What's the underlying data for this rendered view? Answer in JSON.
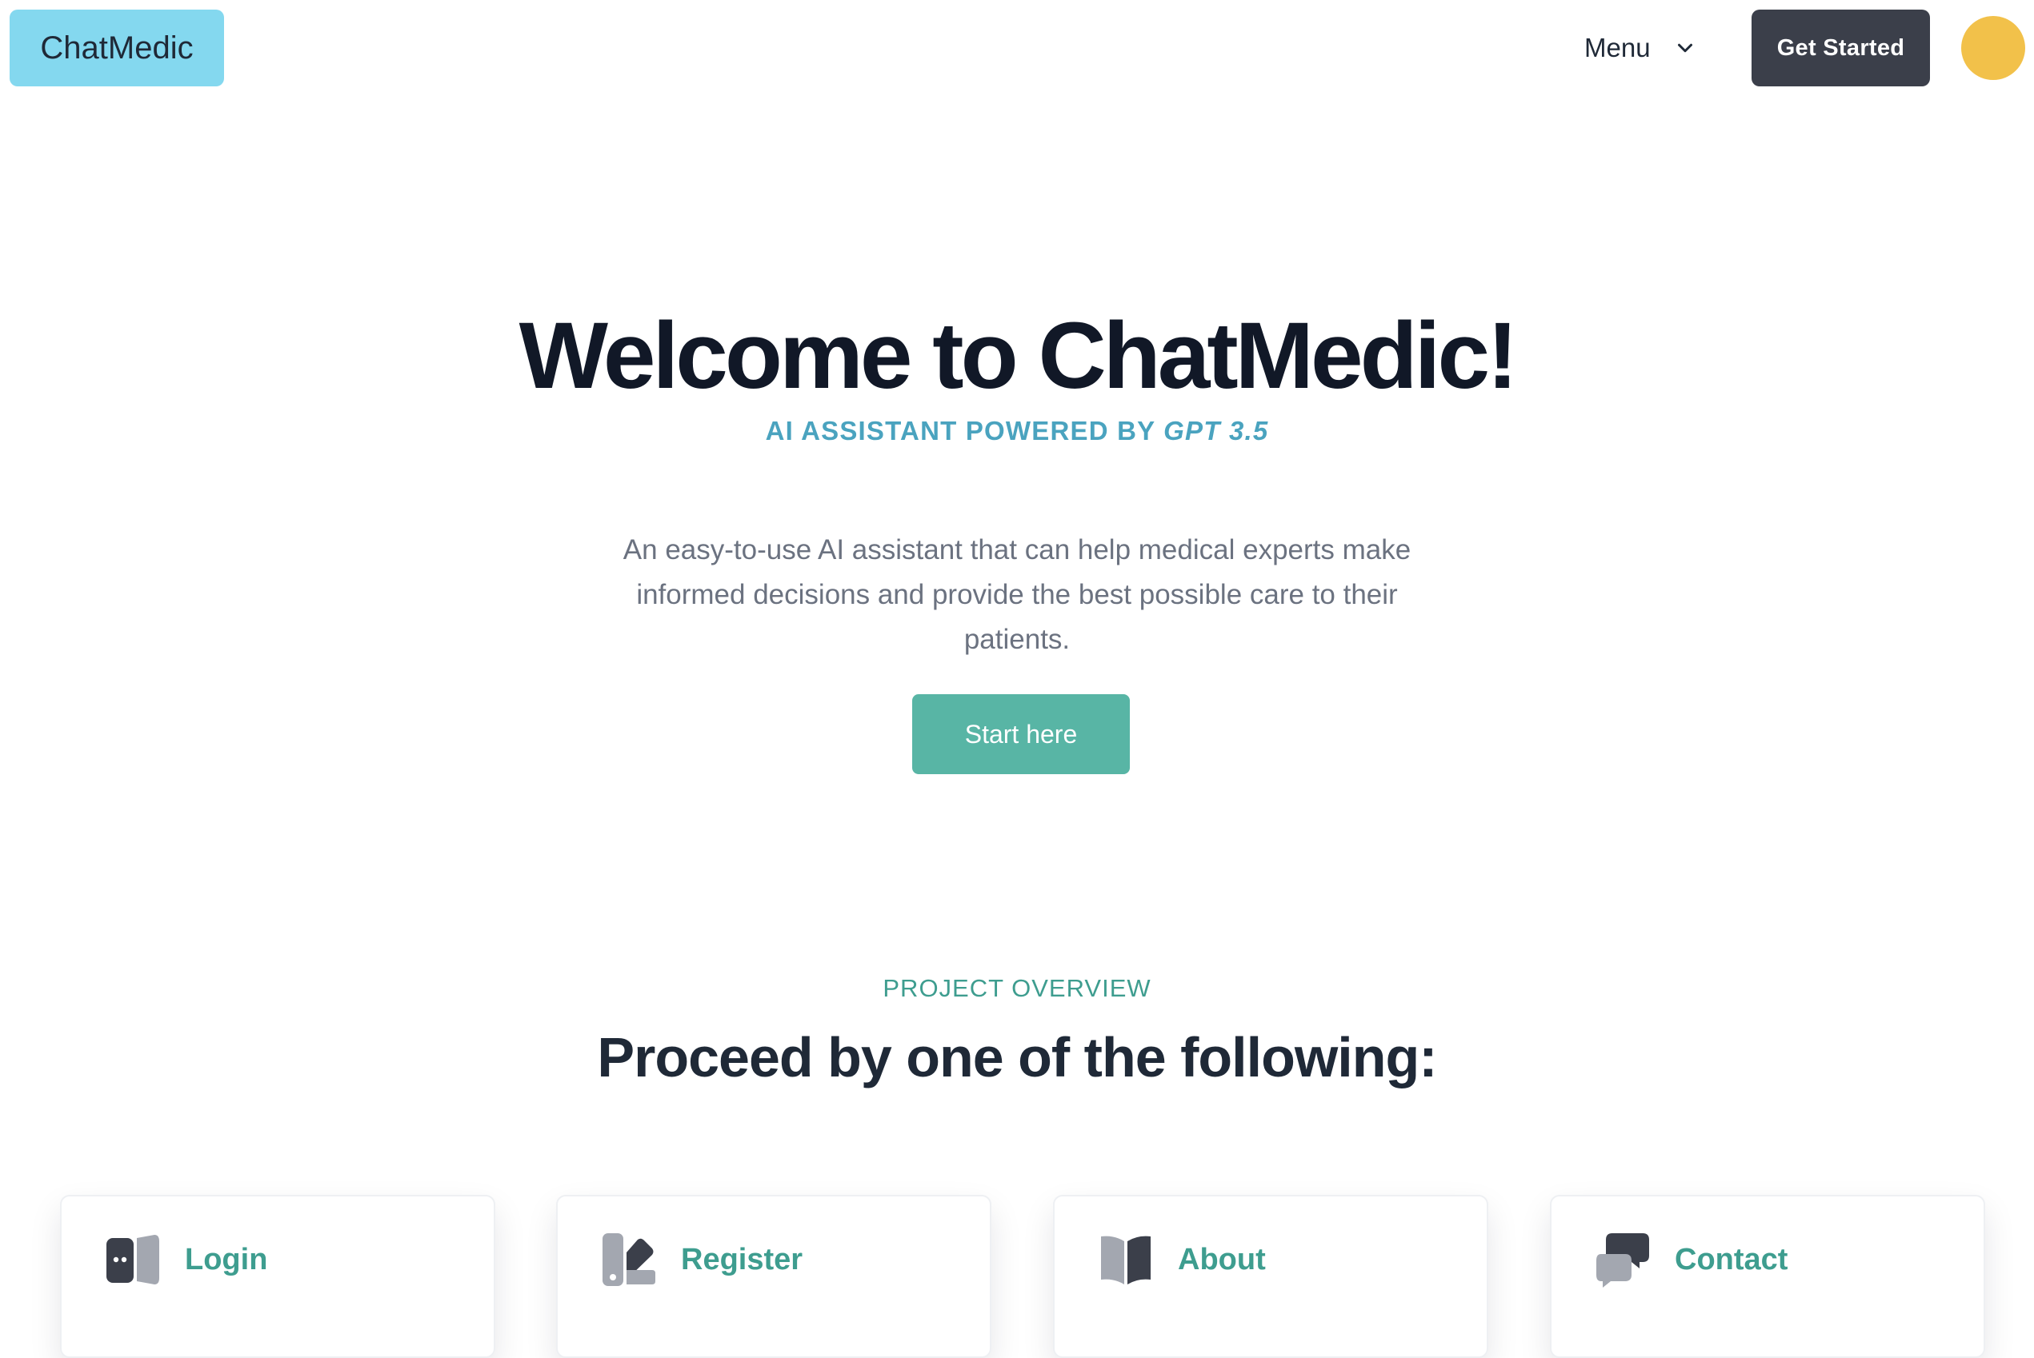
{
  "header": {
    "logo": "ChatMedic",
    "menu_label": "Menu",
    "menu_chevron_icon": "chevron-down-icon",
    "get_started_label": "Get Started",
    "avatar_color": "#f2c14a"
  },
  "hero": {
    "title": "Welcome to ChatMedic!",
    "subtitle_prefix": "AI ASSISTANT POWERED BY ",
    "subtitle_model": "GPT 3.5",
    "description": "An easy-to-use AI assistant that can help medical experts make informed decisions and provide the best possible care to their patients.",
    "cta_label": "Start here"
  },
  "overview": {
    "label": "PROJECT OVERVIEW",
    "title": "Proceed by one of the following:"
  },
  "cards": [
    {
      "label": "Login",
      "icon": "door-icon"
    },
    {
      "label": "Register",
      "icon": "swatch-icon"
    },
    {
      "label": "About",
      "icon": "book-icon"
    },
    {
      "label": "Contact",
      "icon": "chat-bubbles-icon"
    }
  ],
  "colors": {
    "brand": "#84d8ef",
    "accent": "#58b5a5",
    "teal_text": "#3e9d8f",
    "subtitle_blue": "#4aa3bf",
    "dark_button": "#3b3f4a"
  }
}
